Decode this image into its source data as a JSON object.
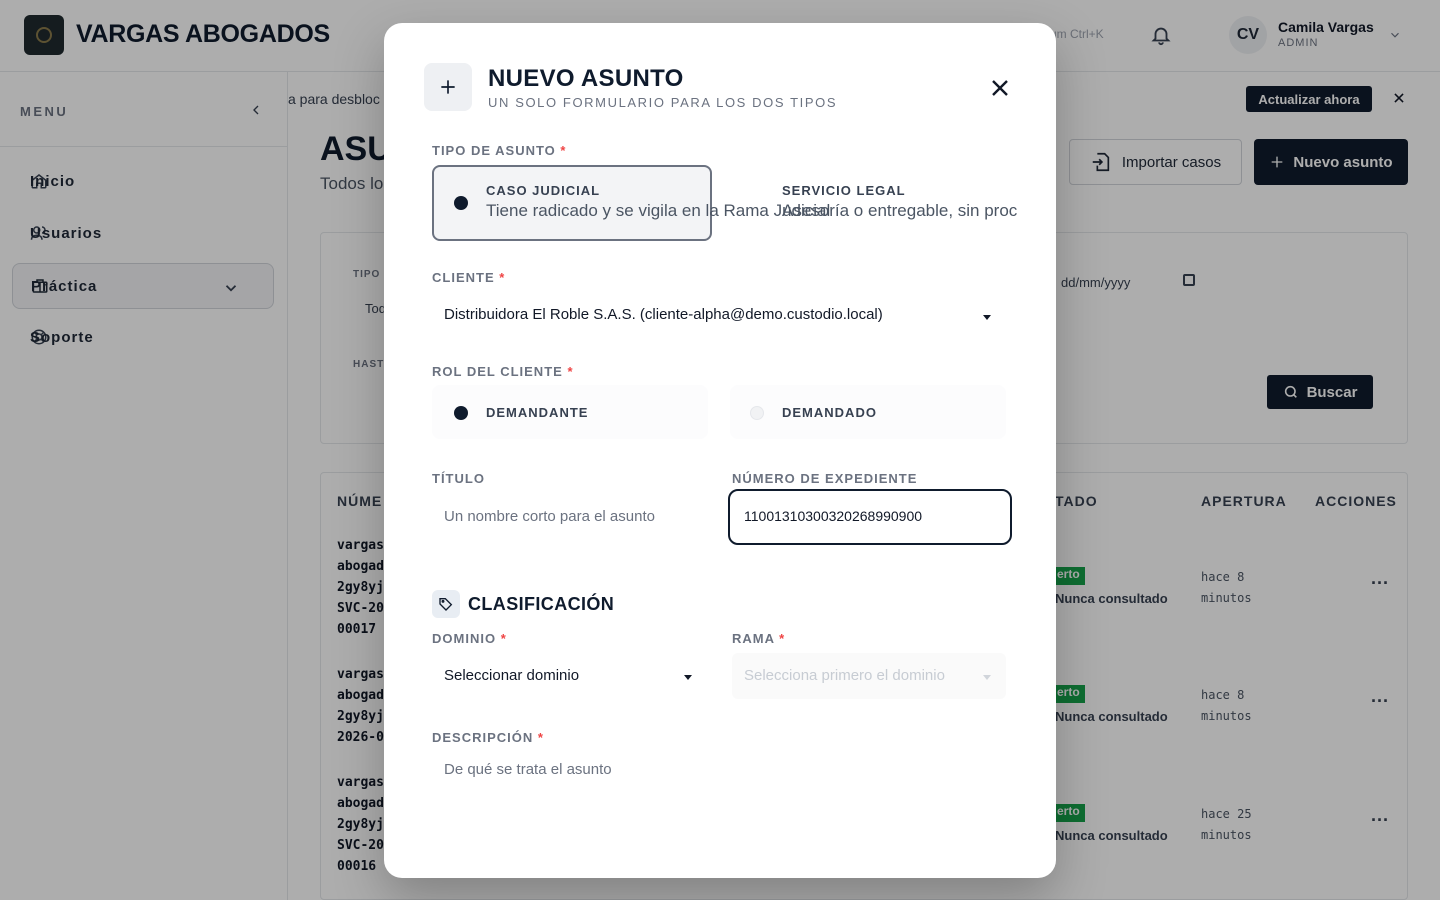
{
  "app": {
    "brand": "VARGAS ABOGADOS",
    "search_hint": "um Ctrl+K",
    "user": {
      "initials": "CV",
      "name": "Camila Vargas",
      "role": "ADMIN"
    }
  },
  "sidebar": {
    "title": "MENU",
    "items": [
      {
        "label": "Inicio",
        "icon": "home-icon"
      },
      {
        "label": "Usuarios",
        "icon": "users-icon"
      },
      {
        "label": "Práctica",
        "icon": "briefcase-icon",
        "active": true
      },
      {
        "label": "Soporte",
        "icon": "lifebuoy-icon"
      }
    ]
  },
  "banner": {
    "text": "a para desbloc",
    "action_label": "Actualizar ahora"
  },
  "page": {
    "title": "ASU",
    "subtitle": "Todos lo",
    "import_label": "Importar casos",
    "new_label": "Nuevo asunto"
  },
  "filters": {
    "tipo_label": "TIPO",
    "tipo_value": "Tod",
    "hasta_label": "HAST",
    "date_placeholder": "dd/mm/yyyy",
    "search_label": "Buscar"
  },
  "table": {
    "headers": {
      "numero": "NÚME",
      "estado": "TADO",
      "apertura": "APERTURA",
      "acciones": "ACCIONES"
    },
    "rows": [
      {
        "numero": "vargas\nabogad\n2gy8yj\nSVC-20\n00017",
        "badge": "erto",
        "consult": "Nunca consultado",
        "time": "hace 8\nminutos"
      },
      {
        "numero": "vargas\nabogad\n2gy8yj\n2026-0",
        "badge": "erto",
        "consult": "Nunca consultado",
        "time": "hace 8\nminutos"
      },
      {
        "numero": "vargas\nabogad\n2gy8yj\nSVC-20\n00016",
        "badge": "erto",
        "consult": "Nunca consultado",
        "time": "hace 25\nminutos"
      }
    ],
    "row_action": "···"
  },
  "modal": {
    "title": "NUEVO ASUNTO",
    "subtitle": "UN SOLO FORMULARIO PARA LOS DOS TIPOS",
    "tipo_label": "TIPO DE ASUNTO",
    "required_mark": "*",
    "tipos": [
      {
        "title": "CASO JUDICIAL",
        "desc": "Tiene radicado y se vigila en la Rama Judicial",
        "selected": true
      },
      {
        "title": "SERVICIO LEGAL",
        "desc": "Asesoría o entregable, sin proc",
        "selected": false
      }
    ],
    "cliente_label": "CLIENTE",
    "cliente_value": "Distribuidora El Roble S.A.S. (cliente-alpha@demo.custodio.local)",
    "rol_label": "ROL DEL CLIENTE",
    "roles": [
      {
        "label": "DEMANDANTE",
        "selected": true
      },
      {
        "label": "DEMANDADO",
        "selected": false
      }
    ],
    "titulo_label": "TÍTULO",
    "titulo_placeholder": "Un nombre corto para el asunto",
    "expediente_label": "NÚMERO DE EXPEDIENTE",
    "expediente_value": "11001310300320268990900",
    "clasificacion_title": "CLASIFICACIÓN",
    "dominio_label": "DOMINIO",
    "dominio_value": "Seleccionar dominio",
    "rama_label": "RAMA",
    "rama_placeholder": "Selecciona primero el dominio",
    "descripcion_label": "DESCRIPCIÓN",
    "descripcion_placeholder": "De qué se trata el asunto"
  },
  "colors": {
    "primary": "#0f1b2d",
    "required": "#ef4444",
    "badge": "#16a34a"
  }
}
